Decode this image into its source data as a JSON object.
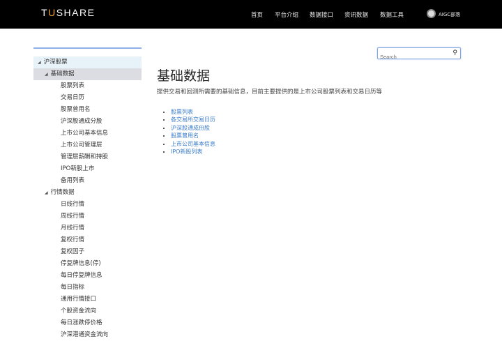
{
  "header": {
    "logo_pre": "T",
    "logo_mid": "U",
    "logo_post": "SHARE",
    "nav": [
      "首页",
      "平台介绍",
      "数据接口",
      "资讯数据",
      "数据工具"
    ],
    "user": "AIGC部落"
  },
  "sidebar": {
    "group": "沪深股票",
    "sections": [
      {
        "label": "基础数据",
        "items": [
          "股票列表",
          "交易日历",
          "股票曾用名",
          "沪深股通成分股",
          "上市公司基本信息",
          "上市公司管理层",
          "管理层薪酬和持股",
          "IPO新股上市",
          "备用列表"
        ]
      },
      {
        "label": "行情数据",
        "items": [
          "日线行情",
          "周线行情",
          "月线行情",
          "复权行情",
          "复权因子",
          "停复牌信息(停)",
          "每日停复牌信息",
          "每日指标",
          "通用行情接口",
          "个股资金流向",
          "每日涨跌停价格",
          "沪深港通资金流向"
        ]
      }
    ]
  },
  "search": {
    "placeholder": "Search"
  },
  "main": {
    "title": "基础数据",
    "description": "提供交易和回测所需要的基础信息，目前主要提供的是上市公司股票列表和交易日历等",
    "links": [
      "股票列表",
      "各交易所交易日历",
      "沪深股通成份股",
      "股票曾用名",
      "上市公司基本信息",
      "IPO新股列表"
    ]
  },
  "colors": {
    "accent": "#f0a030",
    "link": "#3a7bc8"
  }
}
